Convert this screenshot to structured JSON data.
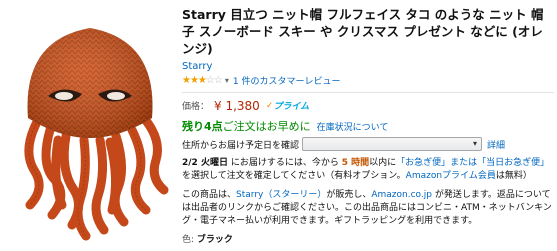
{
  "product": {
    "title": "Starry 目立つ ニット帽 フルフェイス タコ のような ニット 帽子 スノーボード スキー や クリスマス プレゼント などに (オレンジ)",
    "brand": "Starry",
    "rating": {
      "stars": 3,
      "max": 5,
      "reviews_text": "1 件のカスタマーレビュー"
    },
    "price_label": "価格：",
    "price": "¥ 1,380",
    "prime_label": "プライム",
    "stock": {
      "count_text": "残り4点",
      "tail": " ご注文はお早めに",
      "note": "在庫状況について"
    },
    "shipping": {
      "label": "住所からお届け予定日を確認",
      "detail_link": "詳細"
    },
    "delivery": {
      "date": "2/2 火曜日",
      "text1": " にお届けするには、今から ",
      "time": "5 時間",
      "text2": "以内に",
      "option": "「お急ぎ便」または「当日お急ぎ便」",
      "text3": "を選択して注文を確定してください（有料オプション。",
      "member_link": "Amazonプライム会員",
      "text4": "は無料）"
    },
    "seller": {
      "lead": "この商品は、",
      "seller_link": "Starry（スターリー）",
      "mid": "が販売し、",
      "ship_link": "Amazon.co.jp",
      "after": " が発送します。返品については出品者のリンクからご確認ください。この出品商品にはコンビニ・ATM・ネットバンキング・電子マネー払いが利用できます。ギフトラッピングを利用できます。"
    },
    "color_label": "色:",
    "color_value": "ブラック"
  },
  "colors": {
    "hat": "#d2531a",
    "prime": "#00a8e1",
    "price": "#b12704",
    "link": "#0066c0",
    "stock": "#008a00"
  }
}
